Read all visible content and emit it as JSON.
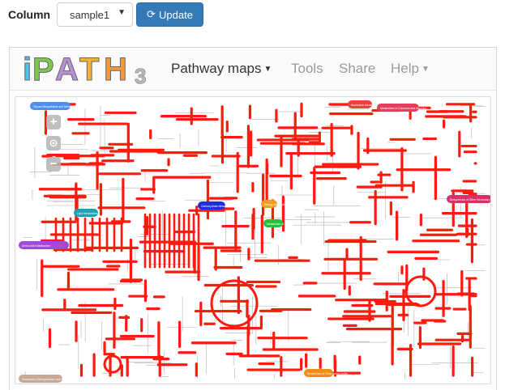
{
  "toolbar": {
    "column_label": "Column",
    "select_value": "sample1",
    "update_label": "Update"
  },
  "ipath": {
    "logo_letters": [
      "i",
      "P",
      "A",
      "T",
      "H"
    ],
    "logo_number": "3",
    "nav": {
      "pathway_maps": "Pathway maps",
      "tools": "Tools",
      "share": "Share",
      "help": "Help"
    },
    "zoom": {
      "in": "+",
      "reset": "⊙",
      "out": "−"
    },
    "map_labels": [
      {
        "text": "Glycan Biosynthesis and Metabolism",
        "color": "#4f8ff0"
      },
      {
        "text": "Nucleotide Metabolism",
        "color": "#e8423a"
      },
      {
        "text": "Metabolism of Cofactors and Vitamins",
        "color": "#e34060"
      },
      {
        "text": "Lipid Metabolism",
        "color": "#1aa3b0"
      },
      {
        "text": "Carbohydrate Metabolism",
        "color": "#1c2fd8"
      },
      {
        "text": "Energy Metabolism",
        "color": "#f39a24"
      },
      {
        "text": "Metabolism of Terpenoids and Polyketides",
        "color": "#25c23a"
      },
      {
        "text": "Biosynthesis of Other Secondary Metabolites",
        "color": "#d8306a"
      },
      {
        "text": "Amino Acid Metabolism",
        "color": "#a04ad8"
      },
      {
        "text": "Metabolism of Other Amino Acids",
        "color": "#f08a18"
      },
      {
        "text": "Xenobiotics Biodegradation and Metabolism",
        "color": "#c7a894"
      }
    ],
    "colors": {
      "highlight": "#ff1a0f",
      "base_line": "#b0b0b0",
      "update_button": "#337ab7"
    }
  }
}
